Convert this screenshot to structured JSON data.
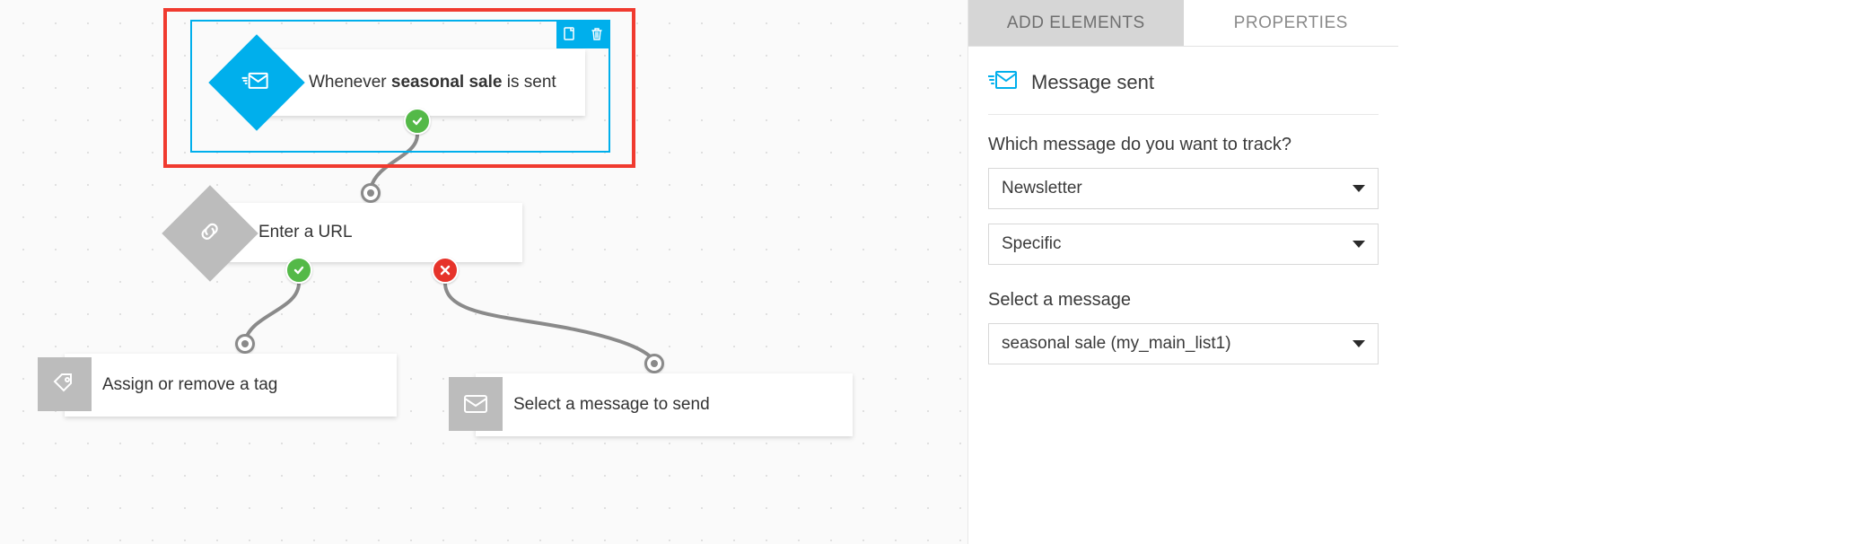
{
  "tabs": {
    "add": "ADD ELEMENTS",
    "properties": "PROPERTIES"
  },
  "properties": {
    "section_title": "Message sent",
    "q1_label": "Which message do you want to track?",
    "select_type": "Newsletter",
    "select_scope": "Specific",
    "q2_label": "Select a message",
    "select_message": "seasonal sale (my_main_list1)"
  },
  "nodes": {
    "trigger": {
      "prefix": "Whenever ",
      "bold": "seasonal sale",
      "suffix": " is sent"
    },
    "url": "Enter a URL",
    "tag": "Assign or remove a tag",
    "send": "Select a message to send"
  }
}
